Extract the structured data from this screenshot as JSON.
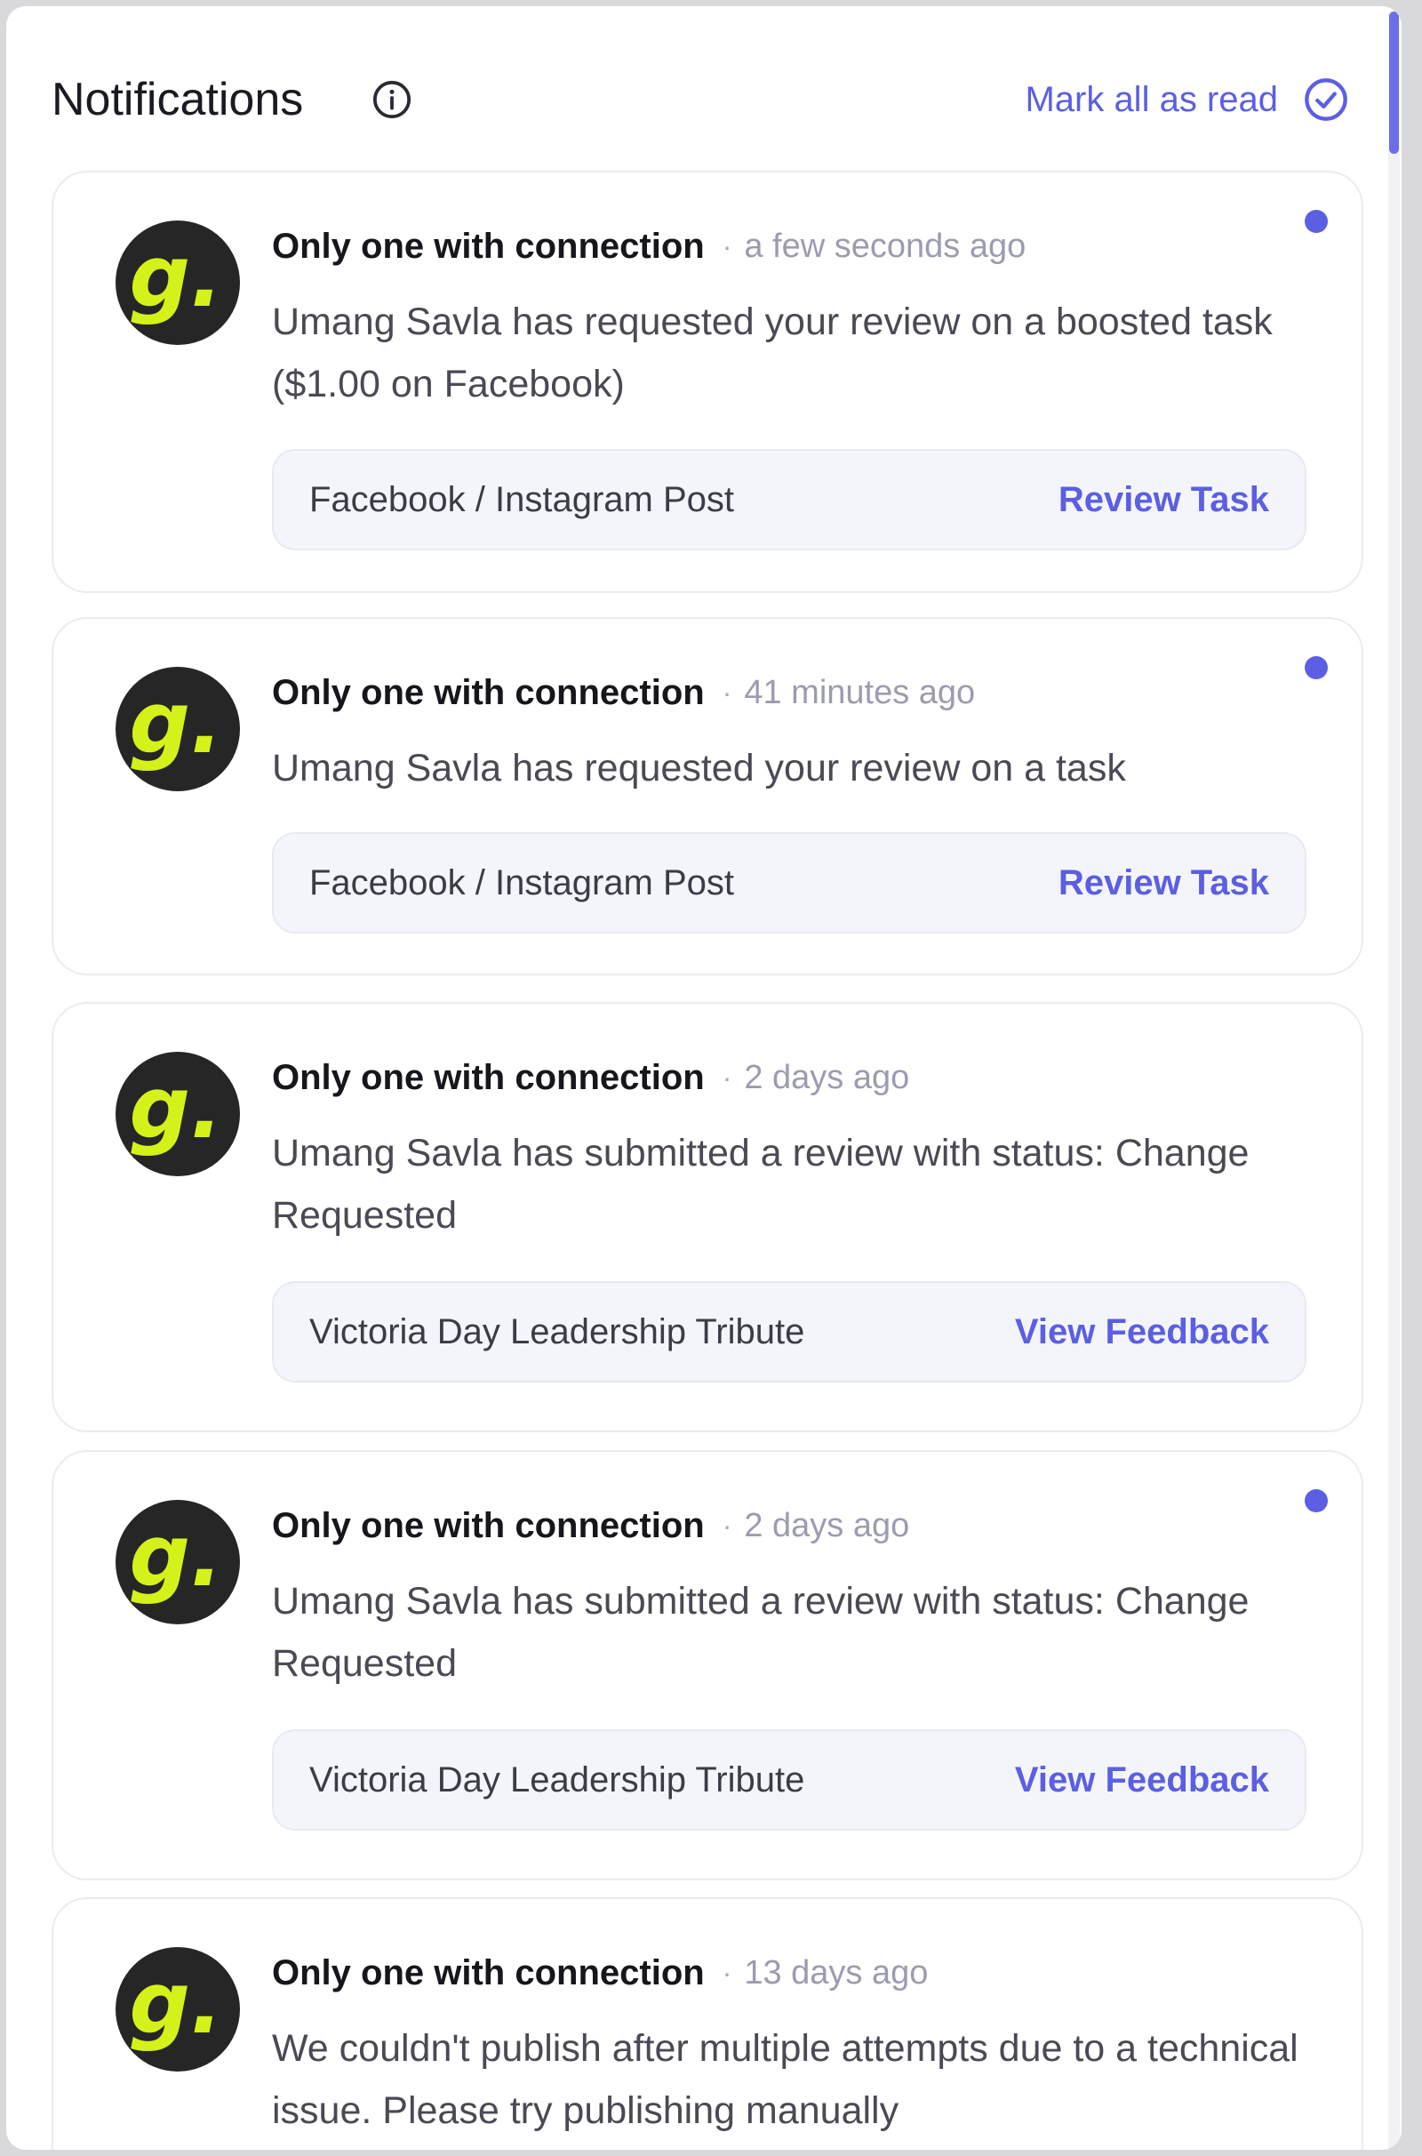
{
  "header": {
    "title": "Notifications",
    "mark_all_label": "Mark all as read"
  },
  "colors": {
    "accent": "#5b5fe3",
    "avatar_bg": "#262626",
    "avatar_letter": "#d4f219"
  },
  "icons": {
    "info": "info-circle-icon",
    "mark_read": "check-circle-icon",
    "avatar": "g-logo-avatar"
  },
  "notifications": [
    {
      "avatar_letter": "g.",
      "sender": "Only one with connection",
      "separator": "·",
      "time": "a few seconds ago",
      "unread": true,
      "message": "Umang Savla has requested your review on a boosted task ($1.00 on Facebook)",
      "task_name": "Facebook / Instagram Post",
      "action_label": "Review Task"
    },
    {
      "avatar_letter": "g.",
      "sender": "Only one with connection",
      "separator": "·",
      "time": "41 minutes ago",
      "unread": true,
      "message": "Umang Savla has requested your review on a task",
      "task_name": "Facebook / Instagram Post",
      "action_label": "Review Task"
    },
    {
      "avatar_letter": "g.",
      "sender": "Only one with connection",
      "separator": "·",
      "time": "2 days ago",
      "unread": false,
      "message": "Umang Savla has submitted a review with status: Change Requested",
      "task_name": "Victoria Day Leadership Tribute",
      "action_label": "View Feedback"
    },
    {
      "avatar_letter": "g.",
      "sender": "Only one with connection",
      "separator": "·",
      "time": "2 days ago",
      "unread": true,
      "message": "Umang Savla has submitted a review with status: Change Requested",
      "task_name": "Victoria Day Leadership Tribute",
      "action_label": "View Feedback"
    },
    {
      "avatar_letter": "g.",
      "sender": "Only one with connection",
      "separator": "·",
      "time": "13 days ago",
      "unread": false,
      "message": "We couldn't publish after multiple attempts due to a technical issue. Please try publishing manually"
    }
  ]
}
